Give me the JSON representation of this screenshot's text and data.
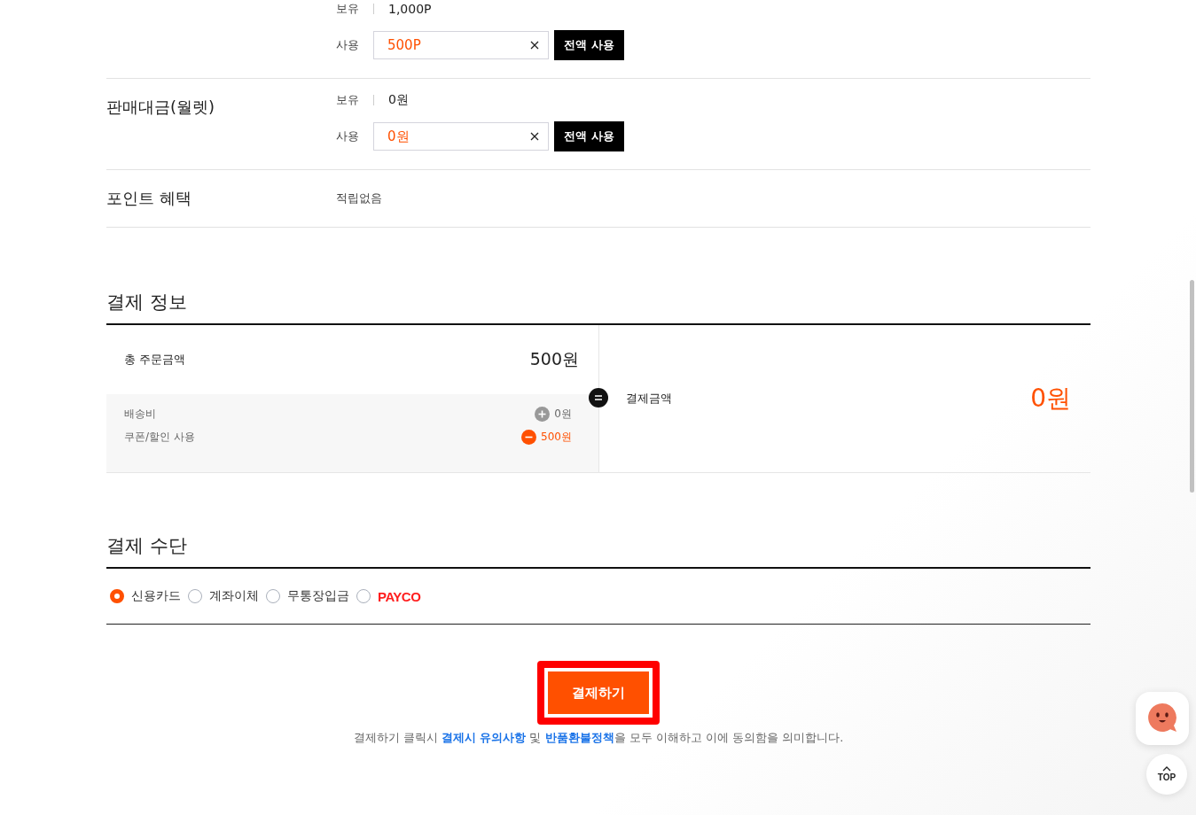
{
  "balance_sections": [
    {
      "holding_label": "보유",
      "holding": "1,000P",
      "use_label": "사용",
      "use_value": "500P",
      "use_all_button": "전액 사용"
    },
    {
      "title": "판매대금(월렛)",
      "holding_label": "보유",
      "holding": "0원",
      "use_label": "사용",
      "use_value": "0원",
      "use_all_button": "전액 사용"
    }
  ],
  "point_benefit": {
    "title": "포인트 혜택",
    "value": "적립없음"
  },
  "payment_info": {
    "title": "결제 정보",
    "total_label": "총 주문금액",
    "total": "500원",
    "lines": [
      {
        "label": "배송비",
        "kind": "plus",
        "value": "0원"
      },
      {
        "label": "쿠폰/할인 사용",
        "kind": "minus",
        "value": "500원"
      }
    ],
    "result_label": "결제금액",
    "result": "0원"
  },
  "payment_method": {
    "title": "결제 수단",
    "options": [
      {
        "label": "신용카드",
        "kind": "text",
        "selected": true
      },
      {
        "label": "계좌이체",
        "kind": "text",
        "selected": false
      },
      {
        "label": "무통장입금",
        "kind": "text",
        "selected": false
      },
      {
        "label": "PAYCO",
        "kind": "brand",
        "selected": false
      }
    ]
  },
  "pay_button": "결제하기",
  "agreement": [
    {
      "text": "결제하기 클릭시 ",
      "kind": "text"
    },
    {
      "text": "결제시 유의사항",
      "kind": "link"
    },
    {
      "text": " 및 ",
      "kind": "text"
    },
    {
      "text": "반품환불정책",
      "kind": "link"
    },
    {
      "text": "을 모두 이해하고 이에 동의함을 의미합니다.",
      "kind": "text"
    }
  ],
  "top_button": "TOP"
}
